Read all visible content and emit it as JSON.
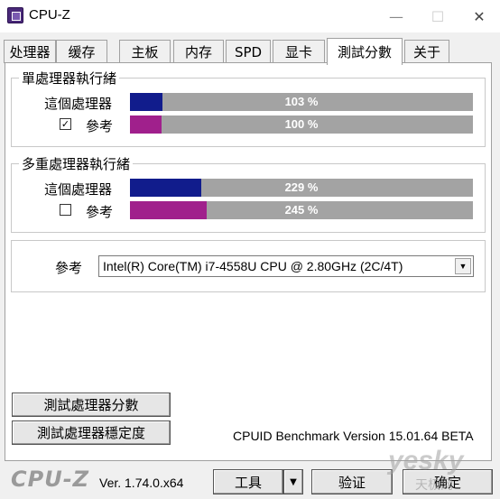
{
  "window": {
    "title": "CPU-Z",
    "minimize": "—",
    "maximize": "☐",
    "close": "✕"
  },
  "tabs": [
    {
      "label": "处理器"
    },
    {
      "label": "缓存"
    },
    {
      "label": "主板"
    },
    {
      "label": "内存"
    },
    {
      "label": "SPD"
    },
    {
      "label": "显卡"
    },
    {
      "label": "測試分數",
      "active": true
    },
    {
      "label": "关于"
    }
  ],
  "single_thread": {
    "title": "單處理器執行緒",
    "this_label": "這個處理器",
    "this_value": "103 %",
    "this_fraction": 0.103,
    "ref_label": "參考",
    "ref_checked": true,
    "ref_check_mark": "✓",
    "ref_value": "100 %",
    "ref_fraction": 0.1
  },
  "multi_thread": {
    "title": "多重處理器執行緒",
    "this_label": "這個處理器",
    "this_value": "229 %",
    "this_fraction": 0.229,
    "ref_label": "參考",
    "ref_checked": false,
    "ref_value": "245 %",
    "ref_fraction": 0.245
  },
  "reference": {
    "label": "參考",
    "selected": "Intel(R) Core(TM) i7-4558U CPU @ 2.80GHz (2C/4T)"
  },
  "actions": {
    "bench_cpu": "測試處理器分數",
    "stress_cpu": "測試處理器穩定度",
    "bench_version": "CPUID Benchmark Version 15.01.64 BETA"
  },
  "footer": {
    "logo": "CPU-Z",
    "version": "Ver. 1.74.0.x64",
    "tools": "工具",
    "validate": "验证",
    "ok": "确定",
    "watermark": "yesky",
    "watermark_sub": "天极网"
  },
  "colors": {
    "this_bar": "#111c8c",
    "ref_bar": "#a0208c",
    "bar_bg": "#a3a3a3"
  }
}
